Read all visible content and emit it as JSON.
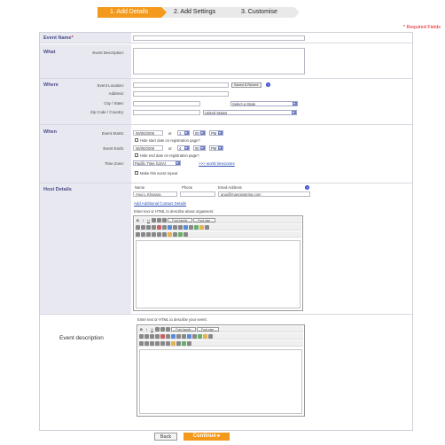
{
  "steps": {
    "step1": "1. Add Details",
    "step2": "2. Add Settings",
    "step3": "3. Customise"
  },
  "required_note": "* Required Fields",
  "event_name": {
    "label": "Event Name",
    "required_mark": "*",
    "value": ""
  },
  "what": {
    "title": "What",
    "description_label": "Event Description:"
  },
  "where": {
    "title": "Where",
    "location_label": "Event Location:",
    "saved_venues": "Saved & Recent",
    "address_label": "Address:",
    "city_state_label": "City / State:",
    "state_placeholder": "Select a State",
    "zip_country_label": "Zip Code / Country:",
    "country_value": "United States"
  },
  "when": {
    "title": "When",
    "starts_label": "Event Starts:",
    "start_date": "06/09/2008",
    "at1": "at",
    "start_hour": "1",
    "start_min": "00",
    "start_ampm": "PM",
    "hide_start": "Hide start date on registration page?",
    "ends_label": "Event Ends:",
    "end_date": "06/09/2008",
    "at2": "at",
    "end_hour": "4",
    "end_min": "00",
    "end_ampm": "PM",
    "hide_end": "Hide end date on registration page?",
    "timezone_label": "Time Zone:",
    "timezone_value": "Pacific Time (USA)",
    "world_timezones": ">>> world timezones",
    "repeat_label": "Make this event repeat"
  },
  "host": {
    "title": "Host Details",
    "name_col": "Name",
    "phone_col": "Phone",
    "email_col": "Email Address",
    "name_value": "Anuj L Khosara",
    "phone_value": "",
    "email_value": "anuj@mangospring.com",
    "add_contact": "Add Additional Contact Details",
    "enter_text": "Enter text or HTML to describe about organisers:"
  },
  "editor_toolbar": {
    "bold": "B",
    "italic": "I",
    "underline": "U",
    "font_family": "-- Font family --",
    "font_size": "-- Font size --"
  },
  "event_description": {
    "title": "Event description",
    "enter_text": "Enter text or HTML to describe your event:"
  },
  "buttons": {
    "back": "Back",
    "continue": "Continue"
  },
  "colors": {
    "accent": "#f39a1c",
    "section_title": "#4b4b8c",
    "required": "#e0161b",
    "link": "#2a4fb5",
    "left_column": "#e8e8f0"
  }
}
